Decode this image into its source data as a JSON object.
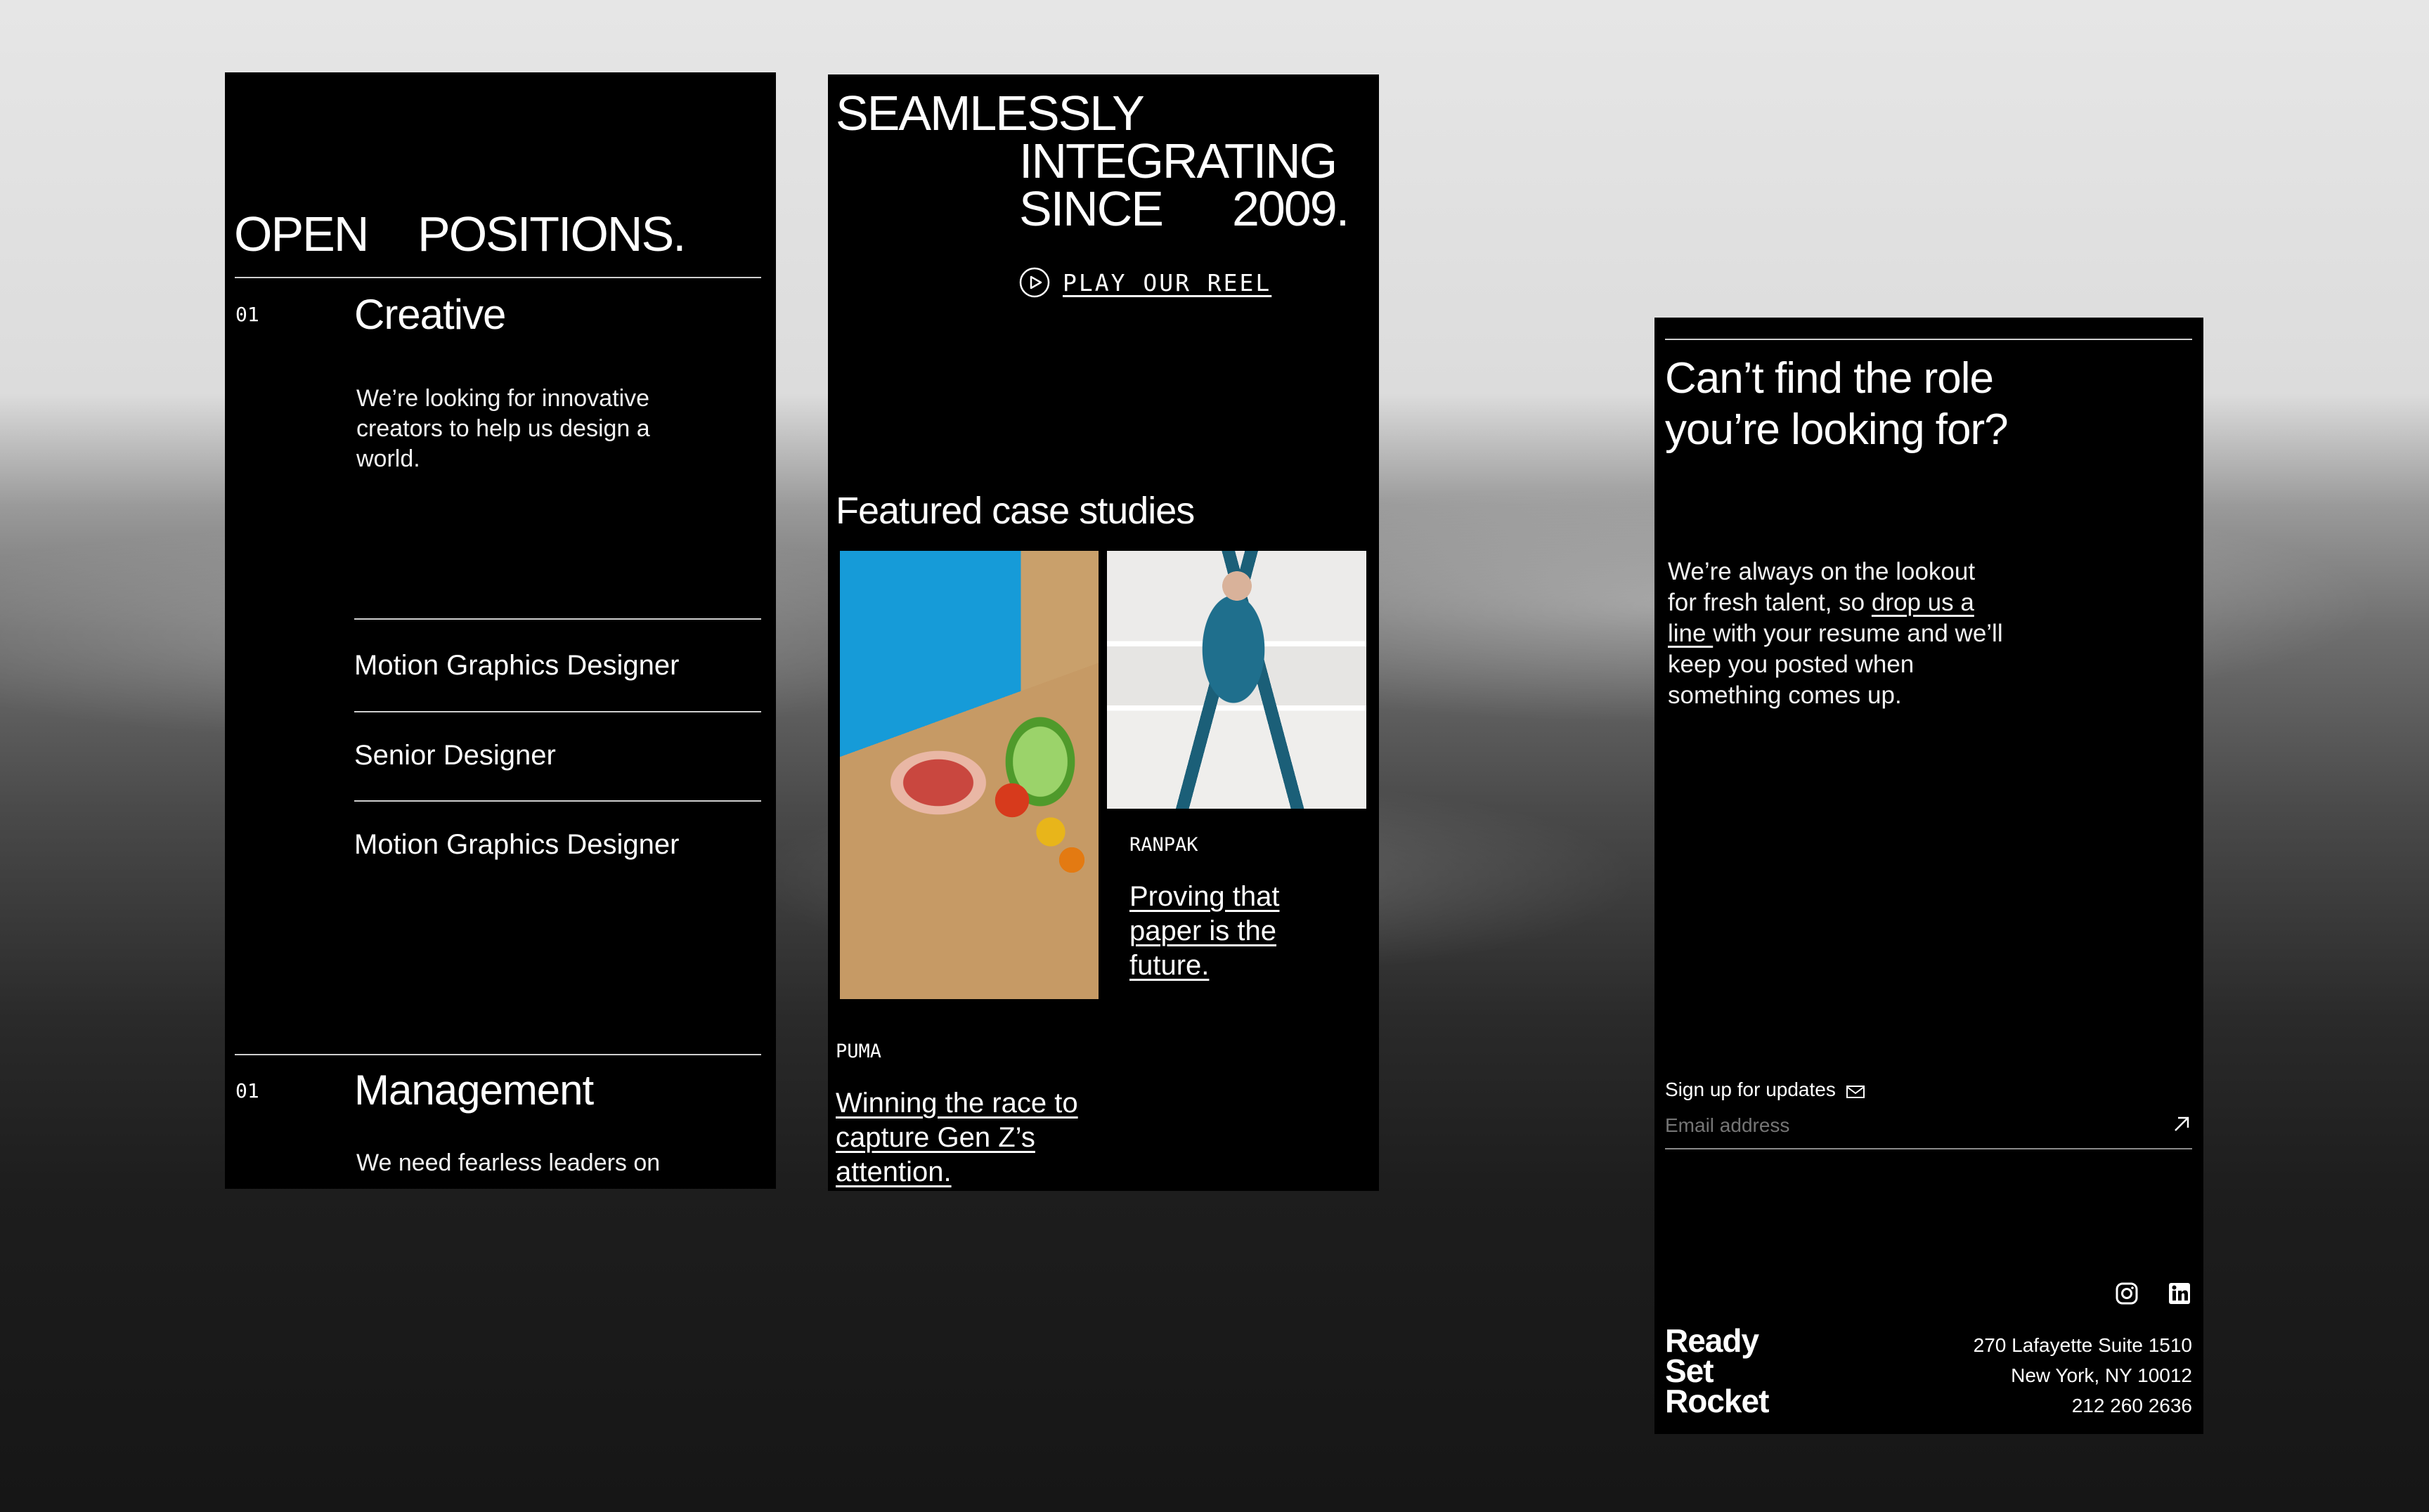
{
  "background": {
    "description_colors": [
      "#e6e6e6",
      "#1a1a1a"
    ]
  },
  "positions_panel": {
    "heading_open": "OPEN",
    "heading_positions": "POSITIONS.",
    "categories": [
      {
        "index": "01",
        "title": "Creative",
        "description": "We’re looking for innovative creators to help us design a world.",
        "jobs": [
          "Motion Graphics Designer",
          "Senior Designer",
          "Motion Graphics Designer"
        ]
      },
      {
        "index": "01",
        "title": "Management",
        "description": "We need fearless leaders on"
      }
    ]
  },
  "home_panel": {
    "hero_line1": "SEAMLESSLY",
    "hero_line2": "INTEGRATING",
    "hero_line3a": "SINCE",
    "hero_line3b": "2009.",
    "reel_label": "PLAY OUR REEL",
    "featured_heading": "Featured case studies",
    "cases": [
      {
        "brand": "PUMA",
        "title": "Winning the race to capture Gen Z’s attention.",
        "title_lines": [
          "Winning the race to",
          "capture Gen Z’s",
          "attention."
        ]
      },
      {
        "brand": "RANPAK",
        "title": "Proving that paper is the future.",
        "title_lines": [
          "Proving that",
          "paper is the",
          "future."
        ]
      }
    ]
  },
  "contact_panel": {
    "question_line1": "Can’t find the role",
    "question_line2": "you’re looking for?",
    "body_before": "We’re always on the lookout for fresh talent, so ",
    "body_link": "drop us a line ",
    "body_after": "with your resume and we’ll keep you posted when something comes up.",
    "body_lines": {
      "l1": "We’re always on the lookout",
      "l2a": "for fresh talent, so ",
      "l2b": "drop us a",
      "l3a": "line ",
      "l3b": "with your resume and we’ll",
      "l4": "keep you posted when",
      "l5": "something comes up."
    },
    "signup_label": "Sign up for updates",
    "email_placeholder": "Email address",
    "logo_lines": [
      "Ready",
      "Set",
      "Rocket"
    ],
    "address_lines": [
      "270 Lafayette Suite 1510",
      "New York, NY 10012",
      "212 260 2636"
    ],
    "icons": [
      "instagram-icon",
      "linkedin-icon",
      "mail-icon",
      "arrow-up-right-icon",
      "play-icon"
    ]
  }
}
